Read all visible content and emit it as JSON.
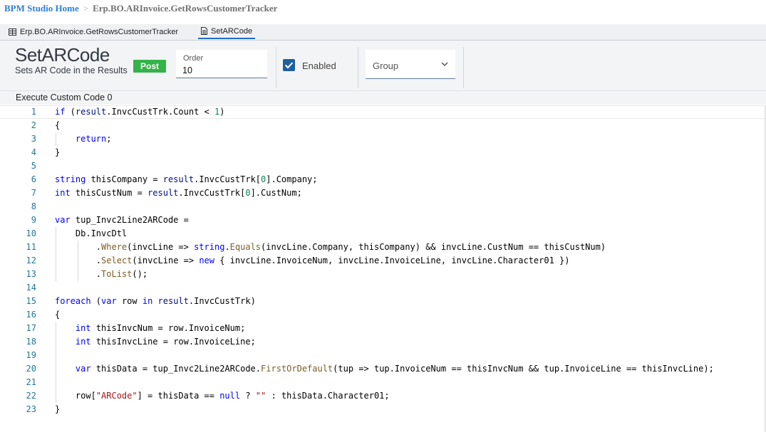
{
  "breadcrumb": {
    "home": "BPM Studio Home",
    "separator": ">",
    "current": "Erp.BO.ARInvoice.GetRowsCustomerTracker"
  },
  "tabs": [
    {
      "label": "Erp.BO.ARInvoice.GetRowsCustomerTracker",
      "icon": "table-icon",
      "active": false
    },
    {
      "label": "SetARCode",
      "icon": "document-icon",
      "active": true
    }
  ],
  "header": {
    "title": "SetARCode",
    "subtitle": "Sets AR Code in the Results",
    "badge": "Post",
    "order": {
      "label": "Order",
      "value": "10"
    },
    "enabled": {
      "label": "Enabled",
      "checked": true
    },
    "group": {
      "label": "Group"
    }
  },
  "section_label": "Execute Custom Code 0",
  "code": {
    "active_line": 1,
    "lines": [
      {
        "n": "1",
        "text": "if (result.InvcCustTrk.Count < 1)"
      },
      {
        "n": "2",
        "text": "{"
      },
      {
        "n": "3",
        "text": "    return;"
      },
      {
        "n": "4",
        "text": "}"
      },
      {
        "n": "5",
        "text": ""
      },
      {
        "n": "6",
        "text": "string thisCompany = result.InvcCustTrk[0].Company;"
      },
      {
        "n": "7",
        "text": "int thisCustNum = result.InvcCustTrk[0].CustNum;"
      },
      {
        "n": "8",
        "text": ""
      },
      {
        "n": "9",
        "text": "var tup_Invc2Line2ARCode ="
      },
      {
        "n": "10",
        "text": "    Db.InvcDtl"
      },
      {
        "n": "11",
        "text": "        .Where(invcLine => string.Equals(invcLine.Company, thisCompany) && invcLine.CustNum == thisCustNum)"
      },
      {
        "n": "12",
        "text": "        .Select(invcLine => new { invcLine.InvoiceNum, invcLine.InvoiceLine, invcLine.Character01 })"
      },
      {
        "n": "13",
        "text": "        .ToList();"
      },
      {
        "n": "14",
        "text": ""
      },
      {
        "n": "15",
        "text": "foreach (var row in result.InvcCustTrk)"
      },
      {
        "n": "16",
        "text": "{"
      },
      {
        "n": "17",
        "text": "    int thisInvcNum = row.InvoiceNum;"
      },
      {
        "n": "18",
        "text": "    int thisInvcLine = row.InvoiceLine;"
      },
      {
        "n": "19",
        "text": ""
      },
      {
        "n": "20",
        "text": "    var thisData = tup_Invc2Line2ARCode.FirstOrDefault(tup => tup.InvoiceNum == thisInvcNum && tup.InvoiceLine == thisInvcLine);"
      },
      {
        "n": "21",
        "text": ""
      },
      {
        "n": "22",
        "text": "    row[\"ARCode\"] = thisData == null ? \"\" : thisData.Character01;"
      },
      {
        "n": "23",
        "text": "}"
      }
    ]
  }
}
